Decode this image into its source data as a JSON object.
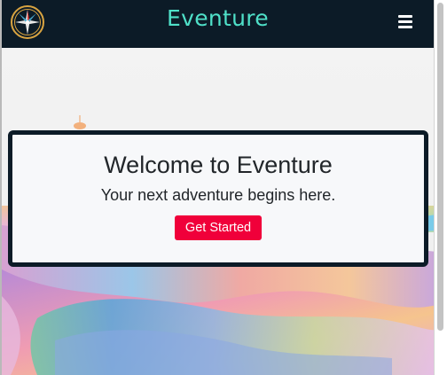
{
  "navbar": {
    "brand": "Eventure",
    "logo_icon": "compass-rose-icon",
    "menu_icon": "hamburger-menu-icon"
  },
  "hero": {
    "title": "Welcome to Eventure",
    "subtitle": "Your next adventure begins here.",
    "cta_label": "Get Started"
  },
  "colors": {
    "navbar_bg": "#0c1b27",
    "brand": "#4fe0c8",
    "cta_bg": "#f0003a",
    "card_border": "#0c1b27"
  }
}
